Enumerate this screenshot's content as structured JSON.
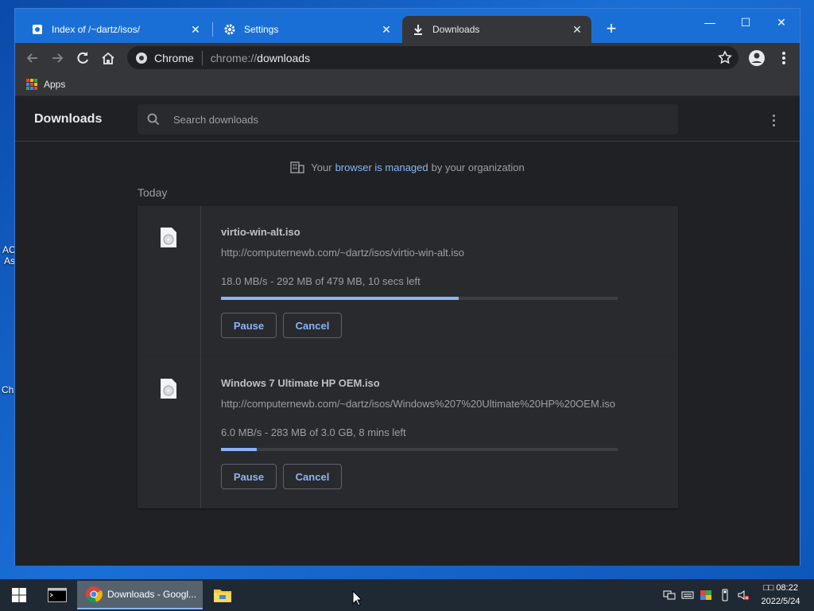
{
  "desktop": {
    "fragments": [
      "AC",
      "As",
      "Ch"
    ]
  },
  "tabs": [
    {
      "label": "Index of /~dartz/isos/",
      "icon": "generic-page-icon"
    },
    {
      "label": "Settings",
      "icon": "gear-icon"
    },
    {
      "label": "Downloads",
      "icon": "download-icon",
      "active": true
    }
  ],
  "tab_close_glyph": "✕",
  "new_tab_glyph": "+",
  "window_controls": {
    "minimize": "—",
    "maximize": "☐",
    "close": "✕"
  },
  "omnibox": {
    "chip_label": "Chrome",
    "scheme": "chrome://",
    "host": "downloads"
  },
  "bookmarks": {
    "apps_label": "Apps"
  },
  "downloads_page": {
    "title": "Downloads",
    "search_placeholder": "Search downloads",
    "managed": {
      "prefix": "Your",
      "link": "browser is managed",
      "suffix": "by your organization"
    },
    "section_label": "Today",
    "items": [
      {
        "name": "virtio-win-alt.iso",
        "url": "http://computernewb.com/~dartz/isos/virtio-win-alt.iso",
        "status": "18.0 MB/s - 292 MB of 479 MB, 10 secs left",
        "progress": 0.6,
        "pause_label": "Pause",
        "cancel_label": "Cancel"
      },
      {
        "name": "Windows 7 Ultimate HP OEM.iso",
        "url": "http://computernewb.com/~dartz/isos/Windows%207%20Ultimate%20HP%20OEM.iso",
        "status": "6.0 MB/s - 283 MB of 3.0 GB, 8 mins left",
        "progress": 0.09,
        "pause_label": "Pause",
        "cancel_label": "Cancel"
      }
    ]
  },
  "taskbar": {
    "chrome_label": "Downloads - Googl...",
    "clock_time": "□□ 08:22",
    "clock_date": "2022/5/24"
  },
  "colors": {
    "accent": "#8ab4f8",
    "background": "#202124",
    "card": "#292a2d",
    "titlebar": "#1a6fd6"
  }
}
